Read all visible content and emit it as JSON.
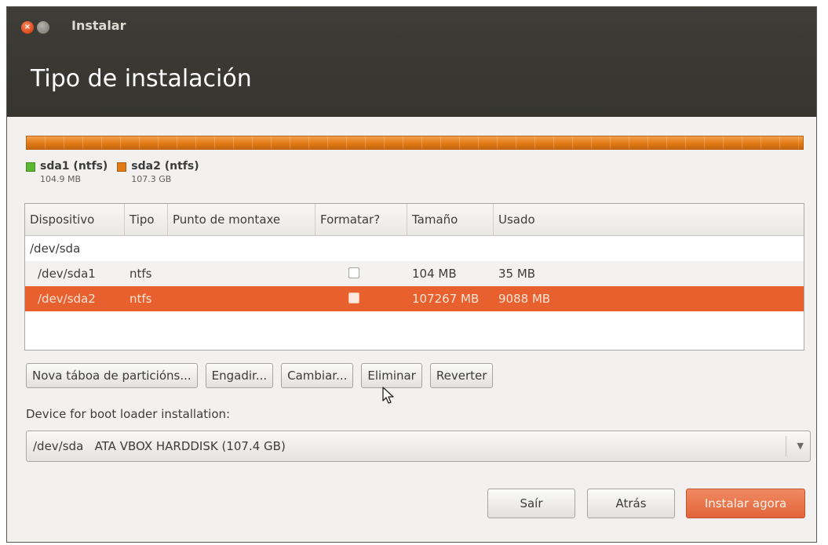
{
  "window": {
    "title": "Instalar",
    "page_title": "Tipo de instalación",
    "close_glyph": "×"
  },
  "colors": {
    "sda1": "#5cb82e",
    "sda2": "#e27b16",
    "selected_row": "#e9602f"
  },
  "partition_legend": [
    {
      "name": "sda1 (ntfs)",
      "size": "104.9 MB"
    },
    {
      "name": "sda2 (ntfs)",
      "size": "107.3 GB"
    }
  ],
  "table": {
    "headers": [
      "Dispositivo",
      "Tipo",
      "Punto de montaxe",
      "Formatar?",
      "Tamaño",
      "Usado"
    ],
    "rows": [
      {
        "device": "/dev/sda",
        "type": "",
        "mount": "",
        "size": "",
        "used": ""
      },
      {
        "device": "/dev/sda1",
        "type": "ntfs",
        "mount": "",
        "size": "104 MB",
        "used": "35 MB"
      },
      {
        "device": "/dev/sda2",
        "type": "ntfs",
        "mount": "",
        "size": "107267 MB",
        "used": "9088 MB"
      }
    ]
  },
  "actions": {
    "new_table": "Nova táboa de particións...",
    "add": "Engadir...",
    "change": "Cambiar...",
    "delete": "Eliminar",
    "revert": "Reverter"
  },
  "boot_loader": {
    "label": "Device for boot loader installation:",
    "selected": "/dev/sda   ATA VBOX HARDDISK (107.4 GB)"
  },
  "footer": {
    "quit": "Saír",
    "back": "Atrás",
    "install": "Instalar agora"
  }
}
